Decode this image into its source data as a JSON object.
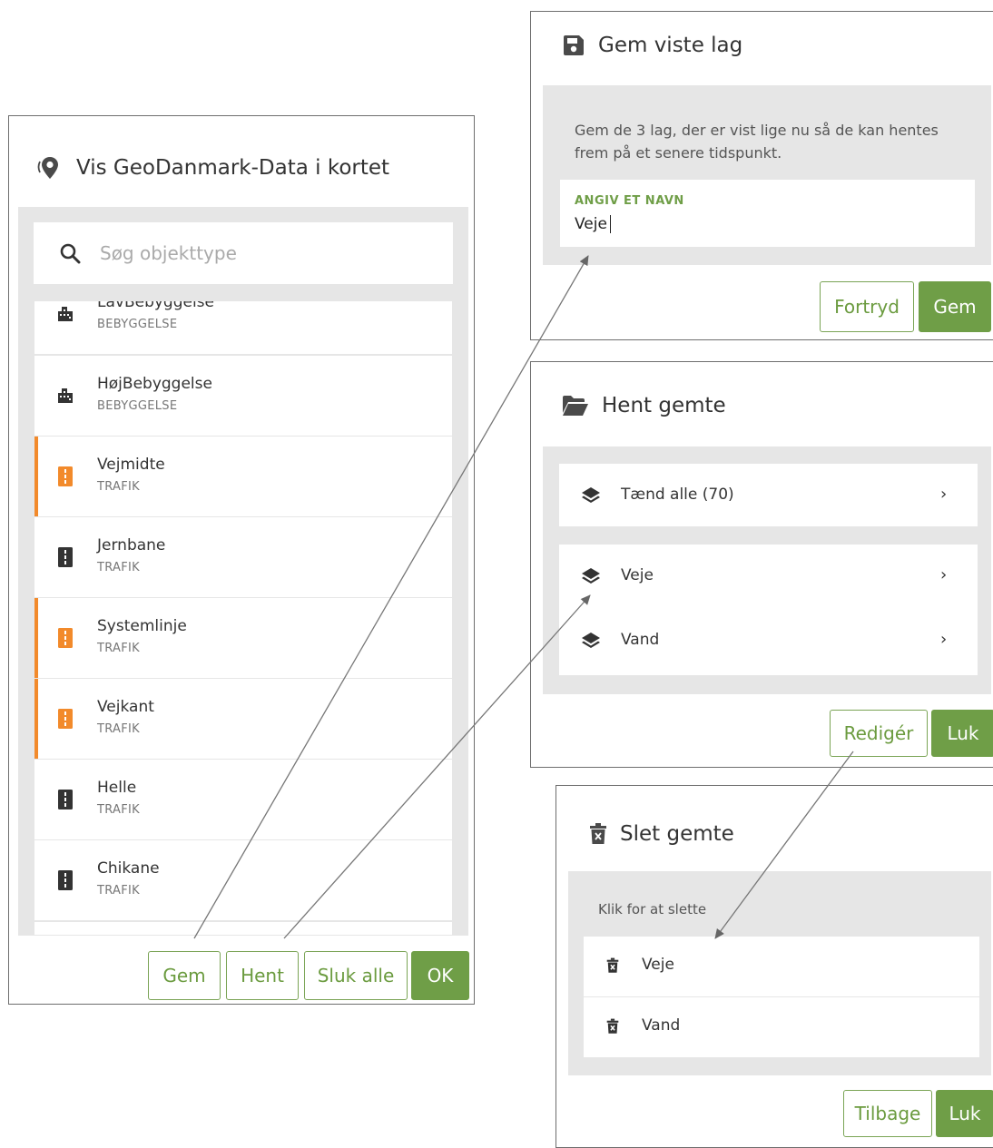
{
  "left_panel": {
    "title": "Vis GeoDanmark-Data i kortet",
    "search_placeholder": "Søg objekttype",
    "partial_item": {
      "name": "LavBebyggelse",
      "category": "BEBYGGELSE"
    },
    "items": [
      {
        "name": "HøjBebyggelse",
        "category": "BEBYGGELSE",
        "icon": "building-icon",
        "active": false
      },
      {
        "name": "Vejmidte",
        "category": "TRAFIK",
        "icon": "road-icon",
        "active": true
      },
      {
        "name": "Jernbane",
        "category": "TRAFIK",
        "icon": "road-icon",
        "active": false
      },
      {
        "name": "Systemlinje",
        "category": "TRAFIK",
        "icon": "road-icon",
        "active": true
      },
      {
        "name": "Vejkant",
        "category": "TRAFIK",
        "icon": "road-icon",
        "active": true
      },
      {
        "name": "Helle",
        "category": "TRAFIK",
        "icon": "road-icon",
        "active": false
      },
      {
        "name": "Chikane",
        "category": "TRAFIK",
        "icon": "road-icon",
        "active": false
      }
    ],
    "buttons": {
      "gem": "Gem",
      "hent": "Hent",
      "sluk_alle": "Sluk alle",
      "ok": "OK"
    }
  },
  "save_panel": {
    "title": "Gem viste lag",
    "description": "Gem de 3 lag, der er vist lige nu så de kan hentes frem på et senere tidspunkt.",
    "field_label": "ANGIV ET NAVN",
    "field_value": "Veje",
    "buttons": {
      "cancel": "Fortryd",
      "save": "Gem"
    }
  },
  "load_panel": {
    "title": "Hent gemte",
    "all_row": "Tænd alle (70)",
    "saved": [
      "Veje",
      "Vand"
    ],
    "buttons": {
      "edit": "Redigér",
      "close": "Luk"
    }
  },
  "delete_panel": {
    "title": "Slet gemte",
    "hint": "Klik for at slette",
    "saved": [
      "Veje",
      "Vand"
    ],
    "buttons": {
      "back": "Tilbage",
      "close": "Luk"
    }
  },
  "colors": {
    "accent_green": "#6f9e47",
    "accent_orange": "#f28a2b",
    "panel_grey": "#e6e6e6",
    "text_dark": "#333333"
  }
}
